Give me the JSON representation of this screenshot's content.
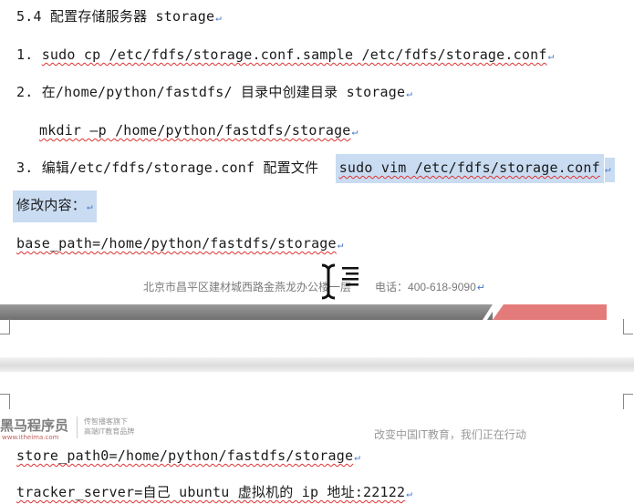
{
  "doc": {
    "heading": "5.4 配置存储服务器 storage",
    "step1_num": "1.",
    "step1_cmd": "sudo cp /etc/fdfs/storage.conf.sample /etc/fdfs/storage.conf",
    "step2_num": "2.",
    "step2_text": "在/home/python/fastdfs/ 目录中创建目录 storage",
    "step2_cmd": "mkdir –p /home/python/fastdfs/storage",
    "step3_num": "3.",
    "step3_text": "编辑/etc/fdfs/storage.conf 配置文件",
    "step3_cmd": "sudo vim /etc/fdfs/storage.conf",
    "modify_label": "修改内容：",
    "base_path": "base_path=/home/python/fastdfs/storage",
    "store_path": "store_path0=/home/python/fastdfs/storage",
    "tracker_server": "tracker_server=自己 ubuntu 虚拟机的 ip 地址:22122"
  },
  "footer": {
    "address": "北京市昌平区建材城西路金燕龙办公楼一层",
    "phone": "电话：400-618-9090"
  },
  "next_header": {
    "logo": "黑马程序员",
    "logo_sub": "www.itheima.com",
    "tagline_1": "传智播客旗下",
    "tagline_2": "高端IT教育品牌",
    "slogan": "改变中国IT教育，我们正在行动"
  },
  "colors": {
    "highlight": "#c9dcf2",
    "paragraph_mark": "#4a78c8",
    "band_gray": "#7a7a7a",
    "band_red": "#e47b7b"
  }
}
